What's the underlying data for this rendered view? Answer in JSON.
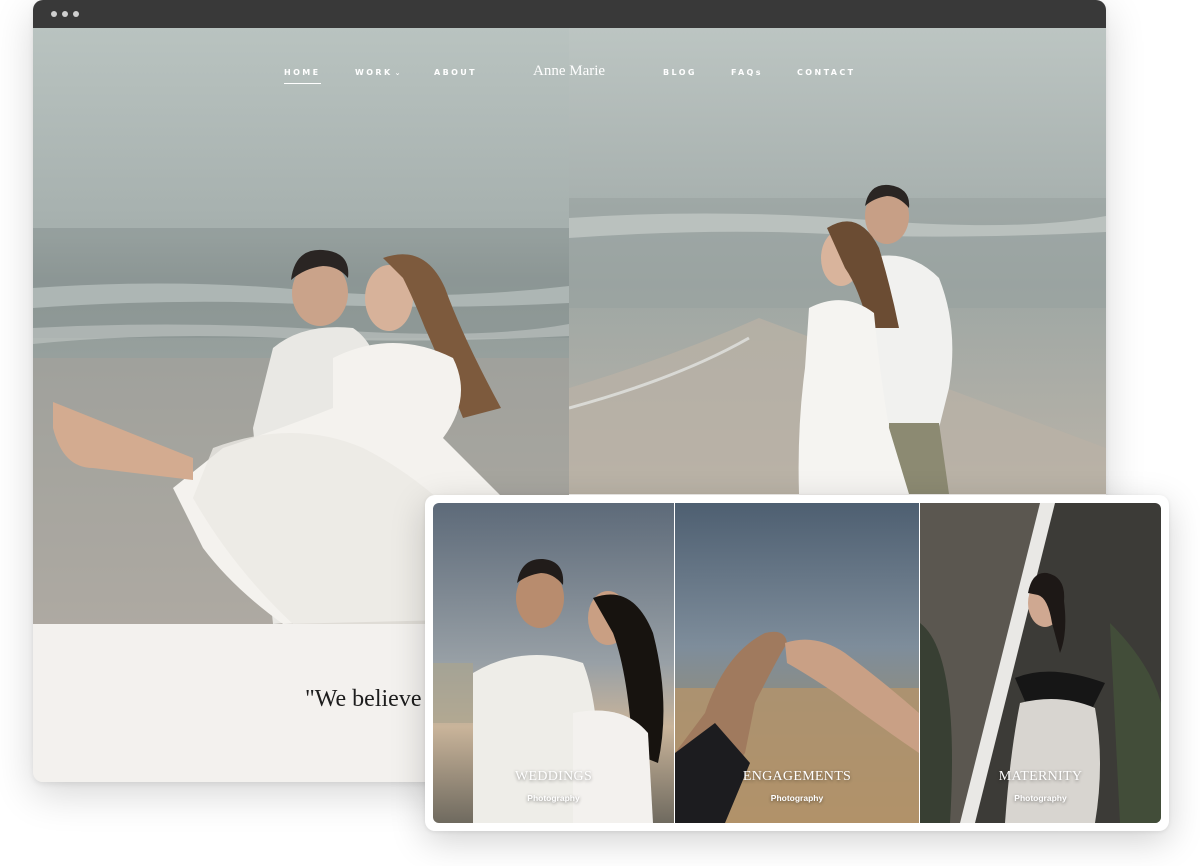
{
  "nav": {
    "items": [
      {
        "label": "HOME",
        "active": true
      },
      {
        "label": "WORK",
        "has_dropdown": true
      },
      {
        "label": "ABOUT"
      },
      {
        "label": "BLOG"
      },
      {
        "label": "FAQs"
      },
      {
        "label": "CONTACT"
      }
    ],
    "logo": "Anne Marie"
  },
  "quote": {
    "text": "\"We believe"
  },
  "categories": [
    {
      "title": "WEDDINGS",
      "subtitle": "Photography"
    },
    {
      "title": "ENGAGEMENTS",
      "subtitle": "Photography"
    },
    {
      "title": "MATERNITY",
      "subtitle": "Photography"
    }
  ],
  "colors": {
    "chrome": "#393939",
    "page_bg": "#f3f1ee",
    "text_dark": "#1d1d1d",
    "nav_text": "#ffffff"
  }
}
